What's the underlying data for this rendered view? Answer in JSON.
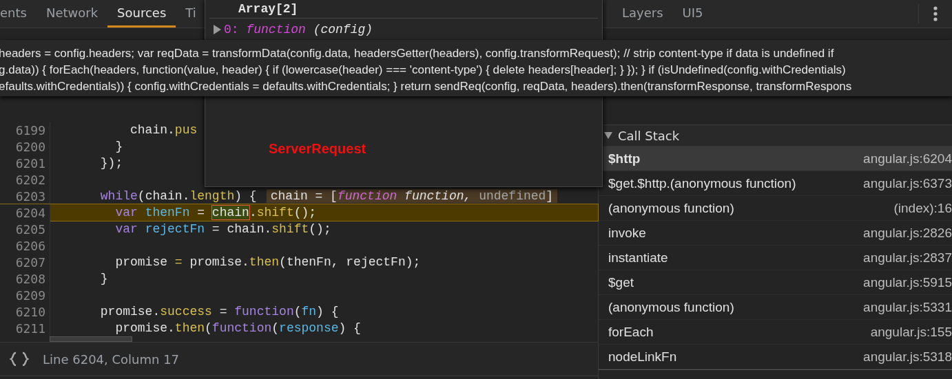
{
  "left_tabs": [
    {
      "label": "ents",
      "selected": false
    },
    {
      "label": "Network",
      "selected": false
    },
    {
      "label": "Sources",
      "selected": true
    },
    {
      "label": "Ti",
      "selected": false
    }
  ],
  "right_tabs": [
    {
      "label": "Layers",
      "selected": false
    },
    {
      "label": "UI5",
      "selected": false
    }
  ],
  "editor": {
    "lines": [
      {
        "number": "6199",
        "current": false,
        "tokens": [
          {
            "text": "          chain.",
            "kind": "plain"
          },
          {
            "text": "pus",
            "kind": "method"
          }
        ]
      },
      {
        "number": "6200",
        "current": false,
        "tokens": [
          {
            "text": "        }",
            "kind": "plain"
          }
        ]
      },
      {
        "number": "6201",
        "current": false,
        "tokens": [
          {
            "text": "      });",
            "kind": "plain"
          }
        ]
      },
      {
        "number": "6202",
        "current": false
      },
      {
        "number": "6203",
        "current": false,
        "tokens": [
          {
            "text": "      while",
            "kind": "keyword"
          },
          {
            "text": "(chain.",
            "kind": "plain"
          },
          {
            "text": "length",
            "kind": "method"
          },
          {
            "text": ") {",
            "kind": "plain"
          }
        ],
        "inline_value": [
          {
            "text": "chain = [",
            "kind": "plain"
          },
          {
            "text": "function",
            "kind": "fn"
          },
          {
            "text": " function, ",
            "kind": "italic"
          },
          {
            "text": "undefined",
            "kind": "muted"
          },
          {
            "text": "]",
            "kind": "plain"
          }
        ]
      },
      {
        "number": "6204",
        "current": true,
        "tokens": [
          {
            "text": "        var",
            "kind": "keyword"
          },
          {
            "text": " thenFn",
            "kind": "name"
          },
          {
            "text": " = ",
            "kind": "plain"
          },
          {
            "text": "chain",
            "kind": "boxed"
          },
          {
            "text": ".",
            "kind": "plain"
          },
          {
            "text": "shift",
            "kind": "method"
          },
          {
            "text": "();",
            "kind": "plain"
          }
        ]
      },
      {
        "number": "6205",
        "current": false,
        "tokens": [
          {
            "text": "        var",
            "kind": "keyword"
          },
          {
            "text": " rejectFn",
            "kind": "name"
          },
          {
            "text": " = chain.",
            "kind": "plain"
          },
          {
            "text": "shift",
            "kind": "method"
          },
          {
            "text": "();",
            "kind": "plain"
          }
        ]
      },
      {
        "number": "6206",
        "current": false
      },
      {
        "number": "6207",
        "current": false,
        "tokens": [
          {
            "text": "        promise ",
            "kind": "plain"
          },
          {
            "text": "=",
            "kind": "method"
          },
          {
            "text": " promise.",
            "kind": "plain"
          },
          {
            "text": "then",
            "kind": "method"
          },
          {
            "text": "(thenFn, rejectFn);",
            "kind": "plain"
          }
        ]
      },
      {
        "number": "6208",
        "current": false,
        "tokens": [
          {
            "text": "      }",
            "kind": "plain"
          }
        ]
      },
      {
        "number": "6209",
        "current": false
      },
      {
        "number": "6210",
        "current": false,
        "tokens": [
          {
            "text": "      promise.",
            "kind": "plain"
          },
          {
            "text": "success",
            "kind": "method"
          },
          {
            "text": " = ",
            "kind": "plain"
          },
          {
            "text": "function",
            "kind": "keyword"
          },
          {
            "text": "(",
            "kind": "plain"
          },
          {
            "text": "fn",
            "kind": "name"
          },
          {
            "text": ") {",
            "kind": "plain"
          }
        ]
      },
      {
        "number": "6211",
        "current": false,
        "tokens": [
          {
            "text": "        promise.",
            "kind": "plain"
          },
          {
            "text": "then",
            "kind": "method"
          },
          {
            "text": "(",
            "kind": "plain"
          },
          {
            "text": "function",
            "kind": "keyword"
          },
          {
            "text": "(",
            "kind": "plain"
          },
          {
            "text": "response",
            "kind": "name"
          },
          {
            "text": ") {",
            "kind": "plain"
          }
        ]
      }
    ]
  },
  "status_bar": {
    "position": "Line 6204, Column 17"
  },
  "popover": {
    "title": "Array[2]",
    "entry": {
      "key": "0:",
      "keyword": "function",
      "params": "(config)"
    },
    "label": "ServerRequest"
  },
  "tooltip": {
    "lines": [
      "headers = config.headers; var reqData = transformData(config.data, headersGetter(headers), config.transformRequest); // strip content-type if data is undefined if",
      "g.data)) { forEach(headers, function(value, header) { if (lowercase(header) === 'content-type') { delete headers[header]; } }); } if (isUndefined(config.withCredentials)",
      "efaults.withCredentials)) { config.withCredentials = defaults.withCredentials; } return sendReq(config, reqData, headers).then(transformResponse, transformRespons"
    ]
  },
  "call_stack": {
    "title": "Call Stack",
    "expanded": true,
    "frames": [
      {
        "name": "$http",
        "location": "angular.js:6204",
        "selected": true
      },
      {
        "name": "$get.$http.(anonymous function)",
        "location": "angular.js:6373",
        "selected": false
      },
      {
        "name": "(anonymous function)",
        "location": "(index):16",
        "selected": false
      },
      {
        "name": "invoke",
        "location": "angular.js:2826",
        "selected": false
      },
      {
        "name": "instantiate",
        "location": "angular.js:2837",
        "selected": false
      },
      {
        "name": "$get",
        "location": "angular.js:5915",
        "selected": false
      },
      {
        "name": "(anonymous function)",
        "location": "angular.js:5331",
        "selected": false
      },
      {
        "name": "forEach",
        "location": "angular.js:155",
        "selected": false
      },
      {
        "name": "nodeLinkFn",
        "location": "angular.js:5318",
        "selected": false
      }
    ]
  }
}
